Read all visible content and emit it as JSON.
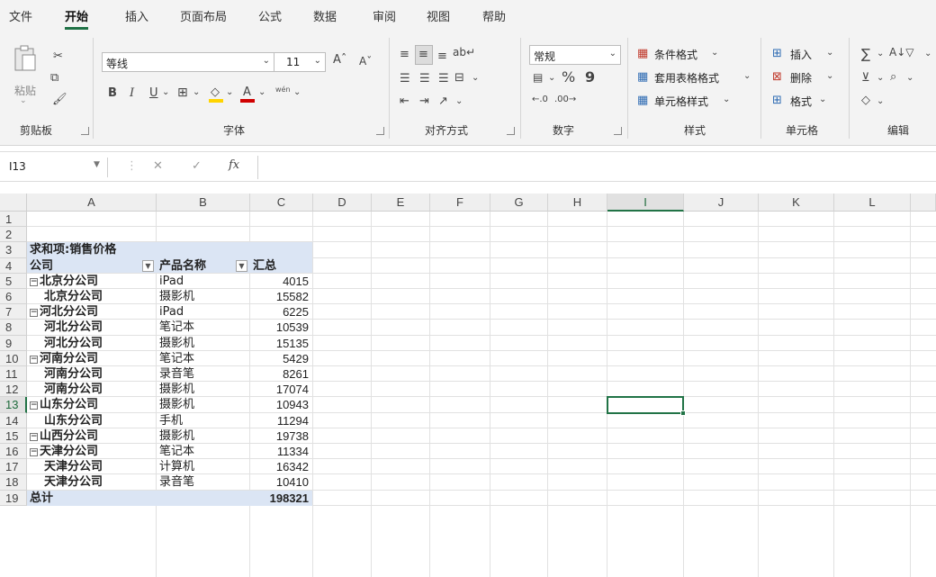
{
  "tabs": [
    "文件",
    "开始",
    "插入",
    "页面布局",
    "公式",
    "数据",
    "审阅",
    "视图",
    "帮助"
  ],
  "ribbon": {
    "clipboard": {
      "paste": "粘贴",
      "label": "剪贴板"
    },
    "font": {
      "name": "等线",
      "size": "11",
      "bold": "B",
      "italic": "I",
      "underline": "U",
      "label": "字体",
      "phonetic": "wén"
    },
    "alignment": {
      "label": "对齐方式"
    },
    "number": {
      "format": "常规",
      "percent": "%",
      "comma": "9",
      "label": "数字"
    },
    "styles": {
      "conditional": "条件格式",
      "table": "套用表格格式",
      "cell_styles": "单元格样式",
      "label": "样式"
    },
    "cells": {
      "insert": "插入",
      "delete": "删除",
      "format": "格式",
      "label": "单元格"
    },
    "editing": {
      "label": "编辑"
    }
  },
  "formula_bar": {
    "name_box": "I13",
    "fx": "fx",
    "value": ""
  },
  "columns": [
    "A",
    "B",
    "C",
    "D",
    "E",
    "F",
    "G",
    "H",
    "I",
    "J",
    "K",
    "L"
  ],
  "selected_column": "I",
  "selected_row": "13",
  "rows": [
    "1",
    "2",
    "3",
    "4",
    "5",
    "6",
    "7",
    "8",
    "9",
    "10",
    "11",
    "12",
    "13",
    "14",
    "15",
    "16",
    "17",
    "18",
    "19"
  ],
  "pivot": {
    "title": "求和项:销售价格",
    "headers": [
      "公司",
      "产品名称",
      "汇总"
    ],
    "records": [
      {
        "company": "北京分公司",
        "product": "iPad",
        "total": "4015",
        "group_start": true
      },
      {
        "company": "北京分公司",
        "product": "摄影机",
        "total": "15582",
        "group_start": false
      },
      {
        "company": "河北分公司",
        "product": "iPad",
        "total": "6225",
        "group_start": true
      },
      {
        "company": "河北分公司",
        "product": "笔记本",
        "total": "10539",
        "group_start": false
      },
      {
        "company": "河北分公司",
        "product": "摄影机",
        "total": "15135",
        "group_start": false
      },
      {
        "company": "河南分公司",
        "product": "笔记本",
        "total": "5429",
        "group_start": true
      },
      {
        "company": "河南分公司",
        "product": "录音笔",
        "total": "8261",
        "group_start": false
      },
      {
        "company": "河南分公司",
        "product": "摄影机",
        "total": "17074",
        "group_start": false
      },
      {
        "company": "山东分公司",
        "product": "摄影机",
        "total": "10943",
        "group_start": true
      },
      {
        "company": "山东分公司",
        "product": "手机",
        "total": "11294",
        "group_start": false
      },
      {
        "company": "山西分公司",
        "product": "摄影机",
        "total": "19738",
        "group_start": true
      },
      {
        "company": "天津分公司",
        "product": "笔记本",
        "total": "11334",
        "group_start": true
      },
      {
        "company": "天津分公司",
        "product": "计算机",
        "total": "16342",
        "group_start": false
      },
      {
        "company": "天津分公司",
        "product": "录音笔",
        "total": "10410",
        "group_start": false
      }
    ],
    "grand_total_label": "总计",
    "grand_total_value": "198321"
  },
  "colors": {
    "accent": "#217346",
    "pivot_header": "#dbe5f4"
  }
}
